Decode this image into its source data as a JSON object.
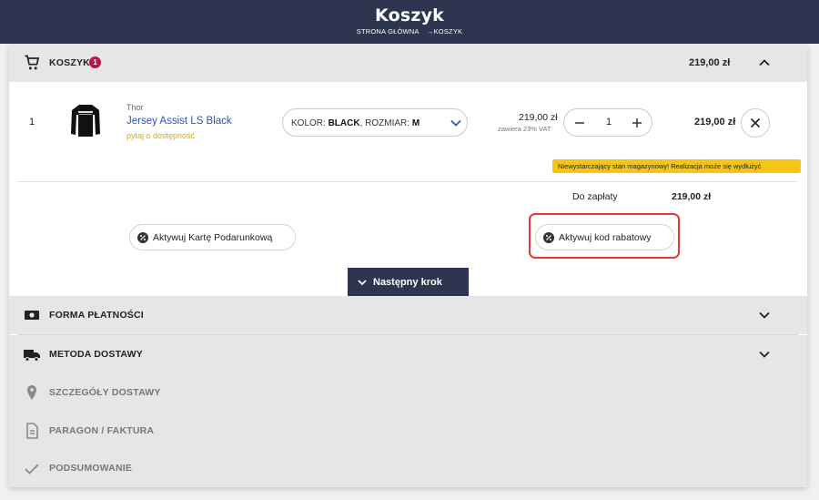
{
  "header": {
    "title": "Koszyk",
    "breadcrumb": [
      "STRONA GŁÓWNA",
      "→KOSZYK"
    ]
  },
  "cart": {
    "section_label": "KOSZYK",
    "badge_count": "1",
    "total": "219,00 zł",
    "items": [
      {
        "index": "1",
        "brand": "Thor",
        "name": "Jersey Assist LS Black",
        "availability": "pytaj o dostępność",
        "variant": {
          "color_label": "KOLOR:",
          "color_value": "BLACK",
          "size_label": ", ROZMIAR:",
          "size_value": "M"
        },
        "unit_price": "219,00 zł",
        "vat_note": "zawiera 23% VAT",
        "quantity": "1",
        "line_total": "219,00 zł"
      }
    ],
    "stock_warning": "Niewystarczający stan magazynowy! Realizacja może się wydłużyć",
    "to_pay_label": "Do zapłaty",
    "to_pay_value": "219,00 zł",
    "gift_card_button": "Aktywuj Kartę Podarunkową",
    "promo_code_button": "Aktywuj kod rabatowy",
    "next_step_button": "Następny krok"
  },
  "sections": [
    {
      "label": "FORMA PŁATNOŚCI",
      "icon": "cash-icon",
      "expandable": true
    },
    {
      "label": "METODA DOSTAWY",
      "icon": "truck-icon",
      "expandable": true
    },
    {
      "label": "SZCZEGÓŁY DOSTAWY",
      "icon": "location-pin-icon",
      "expandable": false
    },
    {
      "label": "PARAGON / FAKTURA",
      "icon": "document-icon",
      "expandable": false
    },
    {
      "label": "PODSUMOWANIE",
      "icon": "checkmark-icon",
      "expandable": false
    }
  ],
  "colors": {
    "header_bg": "#2e3550",
    "accent_link": "#2a56b5",
    "badge": "#b5174a",
    "warning": "#f5c518",
    "availability": "#e6a700",
    "highlight_frame": "#e53935"
  }
}
